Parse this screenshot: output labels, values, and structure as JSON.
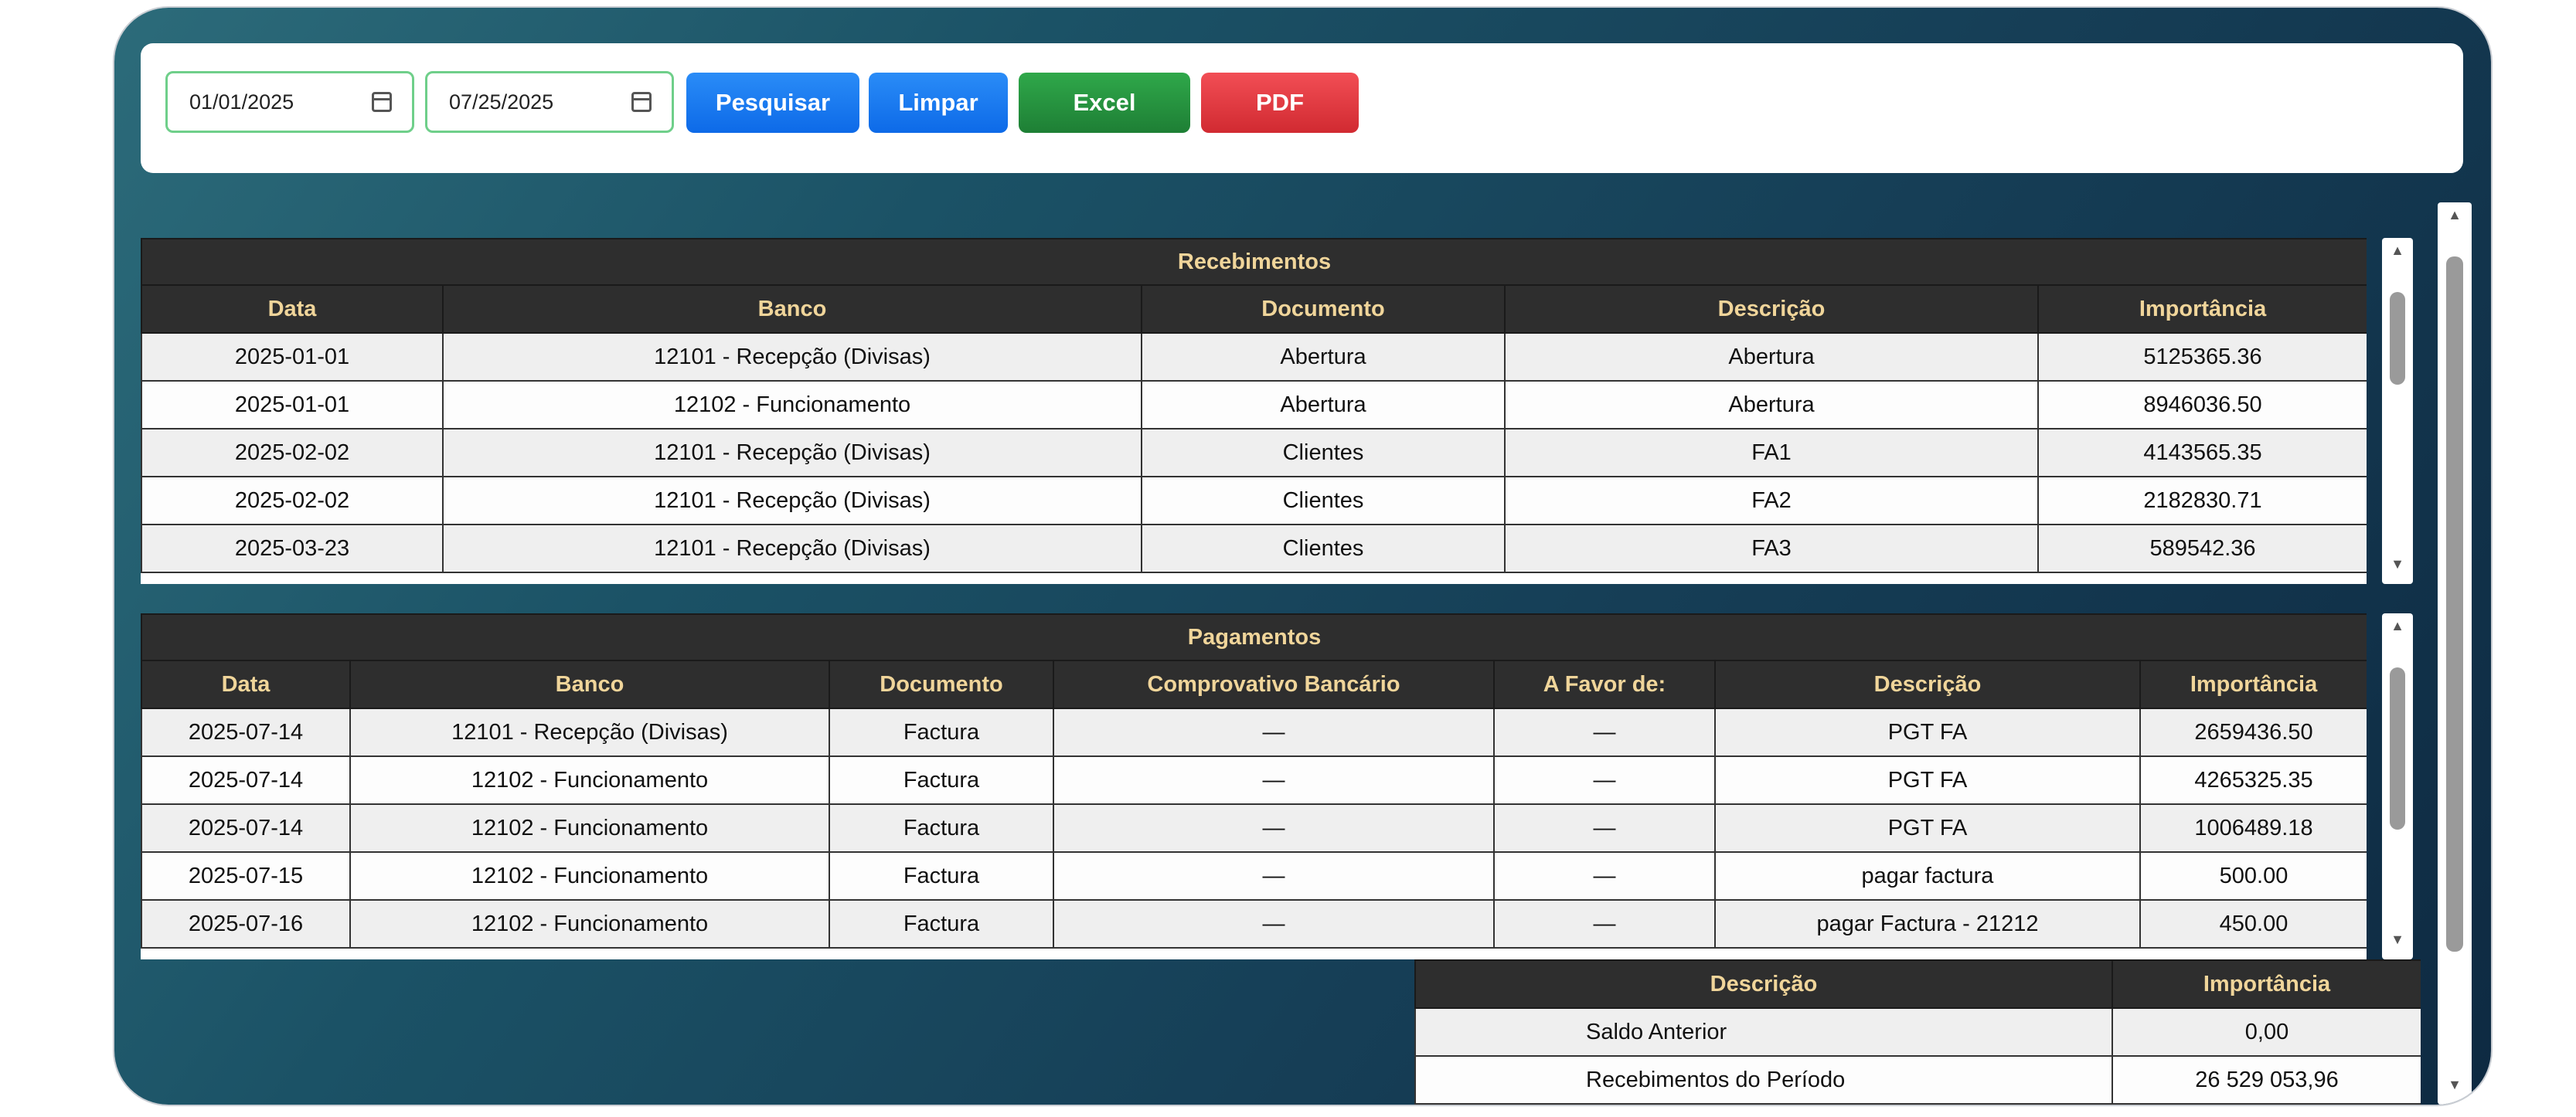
{
  "toolbar": {
    "date_from": "01/01/2025",
    "date_to": "07/25/2025",
    "search_label": "Pesquisar",
    "clear_label": "Limpar",
    "excel_label": "Excel",
    "pdf_label": "PDF"
  },
  "receipts": {
    "title": "Recebimentos",
    "columns": [
      "Data",
      "Banco",
      "Documento",
      "Descrição",
      "Importância"
    ],
    "rows": [
      [
        "2025-01-01",
        "12101 - Recepção (Divisas)",
        "Abertura",
        "Abertura",
        "5125365.36"
      ],
      [
        "2025-01-01",
        "12102 - Funcionamento",
        "Abertura",
        "Abertura",
        "8946036.50"
      ],
      [
        "2025-02-02",
        "12101 - Recepção (Divisas)",
        "Clientes",
        "FA1",
        "4143565.35"
      ],
      [
        "2025-02-02",
        "12101 - Recepção (Divisas)",
        "Clientes",
        "FA2",
        "2182830.71"
      ],
      [
        "2025-03-23",
        "12101 - Recepção (Divisas)",
        "Clientes",
        "FA3",
        "589542.36"
      ]
    ]
  },
  "payments": {
    "title": "Pagamentos",
    "columns": [
      "Data",
      "Banco",
      "Documento",
      "Comprovativo Bancário",
      "A Favor de:",
      "Descrição",
      "Importância"
    ],
    "rows": [
      [
        "2025-07-14",
        "12101 - Recepção (Divisas)",
        "Factura",
        "—",
        "—",
        "PGT FA",
        "2659436.50"
      ],
      [
        "2025-07-14",
        "12102 - Funcionamento",
        "Factura",
        "—",
        "—",
        "PGT FA",
        "4265325.35"
      ],
      [
        "2025-07-14",
        "12102 - Funcionamento",
        "Factura",
        "—",
        "—",
        "PGT FA",
        "1006489.18"
      ],
      [
        "2025-07-15",
        "12102 - Funcionamento",
        "Factura",
        "—",
        "—",
        "pagar factura",
        "500.00"
      ],
      [
        "2025-07-16",
        "12102 - Funcionamento",
        "Factura",
        "—",
        "—",
        "pagar Factura - 21212",
        "450.00"
      ]
    ]
  },
  "summary": {
    "columns": [
      "Descrição",
      "Importância"
    ],
    "rows": [
      [
        "Saldo Anterior",
        "0,00"
      ],
      [
        "Recebimentos do Período",
        "26 529 053,96"
      ]
    ]
  },
  "colors": {
    "header_bg": "#2e2e2e",
    "header_text": "#f0d59a",
    "accent_blue": "#0d6ae8",
    "excel_green": "#1e7f35",
    "pdf_red": "#d12a31"
  }
}
